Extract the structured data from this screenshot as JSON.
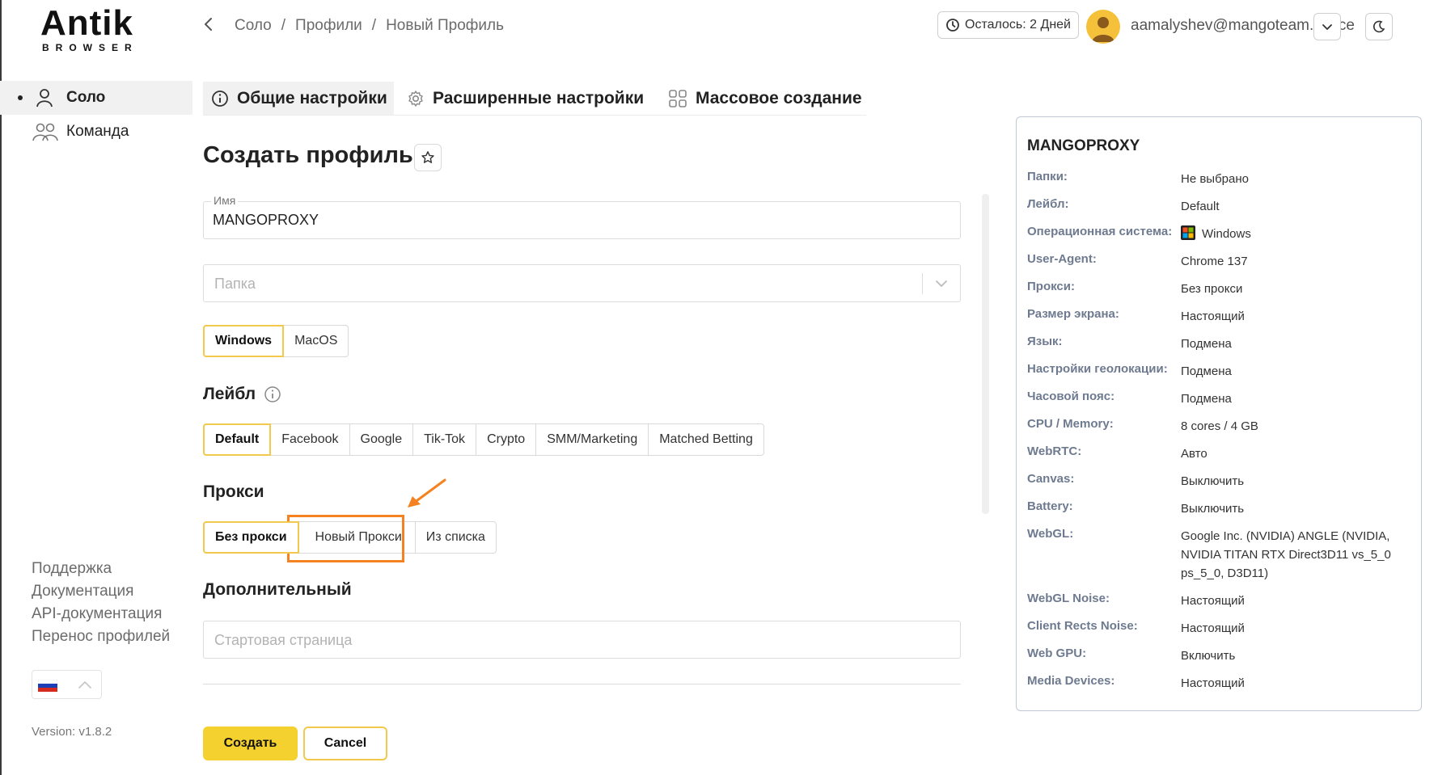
{
  "app": {
    "logo_main": "Antik",
    "logo_sub": "BROWSER"
  },
  "breadcrumbs": [
    "Соло",
    "/",
    "Профили",
    "/",
    "Новый Профиль"
  ],
  "header": {
    "trial_text": "Осталось: 2 Дней",
    "user_email": "aamalyshev@mangoteam.space"
  },
  "sidebar": {
    "items": [
      {
        "label": "Соло",
        "icon": "user-icon"
      },
      {
        "label": "Команда",
        "icon": "team-icon"
      }
    ],
    "links": [
      "Поддержка",
      "Документация",
      "API-документация",
      "Перенос профилей"
    ],
    "version": "Version: v1.8.2"
  },
  "tabs": [
    {
      "label": "Общие настройки",
      "icon": "info-icon"
    },
    {
      "label": "Расширенные настройки",
      "icon": "gear-icon"
    },
    {
      "label": "Массовое создание",
      "icon": "grid-icon"
    }
  ],
  "form": {
    "title": "Создать профиль",
    "name_label": "Имя",
    "name_value": "MANGOPROXY",
    "folder_placeholder": "Папка",
    "os_options": [
      "Windows",
      "MacOS"
    ],
    "os_selected": "Windows",
    "label_section": "Лейбл",
    "label_options": [
      "Default",
      "Facebook",
      "Google",
      "Tik-Tok",
      "Crypto",
      "SMM/Marketing",
      "Matched Betting"
    ],
    "label_selected": "Default",
    "proxy_section": "Прокси",
    "proxy_options": [
      "Без прокси",
      "Новый Прокси",
      "Из списка"
    ],
    "proxy_selected": "Без прокси",
    "extra_section": "Дополнительный",
    "start_page_placeholder": "Стартовая страница",
    "create_button": "Создать",
    "cancel_button": "Cancel"
  },
  "summary": {
    "title": "MANGOPROXY",
    "rows": [
      {
        "key": "Папки:",
        "value": "Не выбрано"
      },
      {
        "key": "Лейбл:",
        "value": "Default"
      },
      {
        "key": "Операционная система:",
        "value": "Windows"
      },
      {
        "key": "User-Agent:",
        "value": "Chrome 137"
      },
      {
        "key": "Прокси:",
        "value": "Без прокси"
      },
      {
        "key": "Размер экрана:",
        "value": "Настоящий"
      },
      {
        "key": "Язык:",
        "value": "Подмена"
      },
      {
        "key": "Настройки геолокации:",
        "value": "Подмена"
      },
      {
        "key": "Часовой пояс:",
        "value": "Подмена"
      },
      {
        "key": "CPU / Memory:",
        "value": "8 cores / 4 GB"
      },
      {
        "key": "WebRTC:",
        "value": "Авто"
      },
      {
        "key": "Canvas:",
        "value": "Выключить"
      },
      {
        "key": "Battery:",
        "value": "Выключить"
      },
      {
        "key": "WebGL:",
        "value": "Google Inc. (NVIDIA) ANGLE (NVIDIA, NVIDIA TITAN RTX Direct3D11 vs_5_0 ps_5_0, D3D11)"
      },
      {
        "key": "WebGL Noise:",
        "value": "Настоящий"
      },
      {
        "key": "Client Rects Noise:",
        "value": "Настоящий"
      },
      {
        "key": "Web GPU:",
        "value": "Включить"
      },
      {
        "key": "Media Devices:",
        "value": "Настоящий"
      }
    ]
  },
  "colors": {
    "accent": "#f5d130",
    "highlight": "#f58220",
    "muted": "#6e7a8f"
  }
}
